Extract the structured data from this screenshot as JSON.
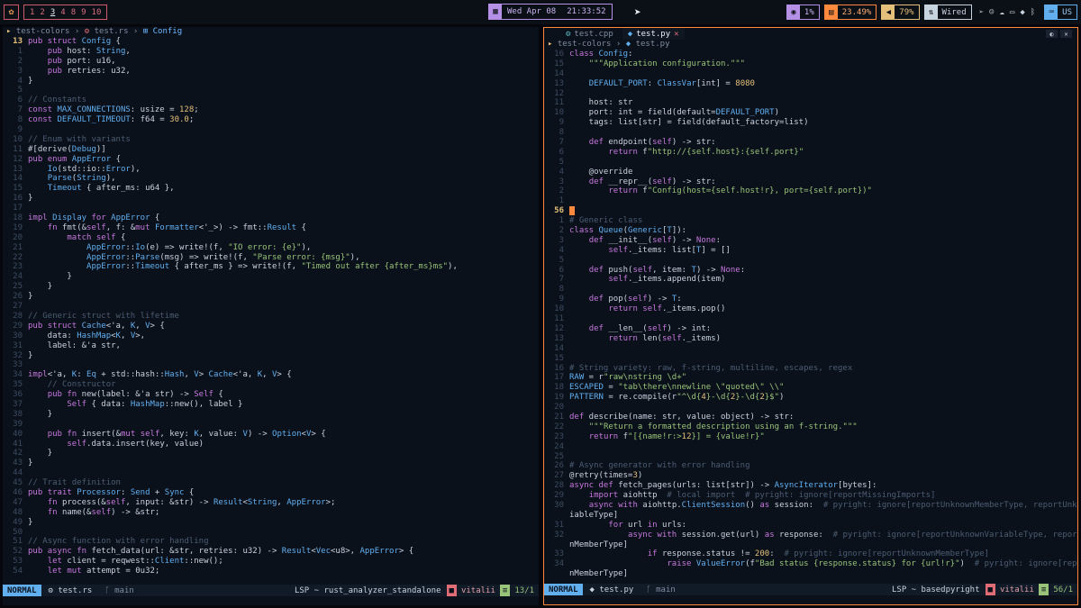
{
  "topbar": {
    "workspaces": [
      "1",
      "2",
      "3",
      "4",
      "8",
      "9",
      "10"
    ],
    "active_workspace": "3",
    "clock": {
      "date": "Wed Apr 08",
      "time": "21:33:52"
    },
    "cpu": "1%",
    "memory": "23.49%",
    "volume": "79%",
    "network": "Wired",
    "keyboard_layout": "US",
    "colors": {
      "cpu": "#b490e6",
      "mem": "#ff8a3d",
      "vol": "#e5c07b",
      "net": "#c8d3e0",
      "kbd": "#61afef"
    }
  },
  "left": {
    "breadcrumb": {
      "folder": "test-colors",
      "file": "test.rs",
      "symbol": "Config"
    },
    "lines": [
      {
        "n": "13",
        "t": "pub struct Config {"
      },
      {
        "n": "1",
        "t": "    pub host: String,"
      },
      {
        "n": "2",
        "t": "    pub port: u16,"
      },
      {
        "n": "3",
        "t": "    pub retries: u32,"
      },
      {
        "n": "4",
        "t": "}"
      },
      {
        "n": "5",
        "t": ""
      },
      {
        "n": "6",
        "t": "// Constants"
      },
      {
        "n": "7",
        "t": "const MAX_CONNECTIONS: usize = 128;"
      },
      {
        "n": "8",
        "t": "const DEFAULT_TIMEOUT: f64 = 30.0;"
      },
      {
        "n": "9",
        "t": ""
      },
      {
        "n": "10",
        "t": "// Enum with variants"
      },
      {
        "n": "11",
        "t": "#[derive(Debug)]"
      },
      {
        "n": "12",
        "t": "pub enum AppError {"
      },
      {
        "n": "13",
        "t": "    Io(std::io::Error),"
      },
      {
        "n": "14",
        "t": "    Parse(String),"
      },
      {
        "n": "15",
        "t": "    Timeout { after_ms: u64 },"
      },
      {
        "n": "16",
        "t": "}"
      },
      {
        "n": "17",
        "t": ""
      },
      {
        "n": "18",
        "t": "impl Display for AppError {"
      },
      {
        "n": "19",
        "t": "    fn fmt(&self, f: &mut Formatter<'_>) -> fmt::Result {"
      },
      {
        "n": "20",
        "t": "        match self {"
      },
      {
        "n": "21",
        "t": "            AppError::Io(e) => write!(f, \"IO error: {e}\"),"
      },
      {
        "n": "22",
        "t": "            AppError::Parse(msg) => write!(f, \"Parse error: {msg}\"),"
      },
      {
        "n": "23",
        "t": "            AppError::Timeout { after_ms } => write!(f, \"Timed out after {after_ms}ms\"),"
      },
      {
        "n": "24",
        "t": "        }"
      },
      {
        "n": "25",
        "t": "    }"
      },
      {
        "n": "26",
        "t": "}"
      },
      {
        "n": "27",
        "t": ""
      },
      {
        "n": "28",
        "t": "// Generic struct with lifetime"
      },
      {
        "n": "29",
        "t": "pub struct Cache<'a, K, V> {"
      },
      {
        "n": "30",
        "t": "    data: HashMap<K, V>,"
      },
      {
        "n": "31",
        "t": "    label: &'a str,"
      },
      {
        "n": "32",
        "t": "}"
      },
      {
        "n": "33",
        "t": ""
      },
      {
        "n": "34",
        "t": "impl<'a, K: Eq + std::hash::Hash, V> Cache<'a, K, V> {"
      },
      {
        "n": "35",
        "t": "    // Constructor"
      },
      {
        "n": "36",
        "t": "    pub fn new(label: &'a str) -> Self {"
      },
      {
        "n": "37",
        "t": "        Self { data: HashMap::new(), label }"
      },
      {
        "n": "38",
        "t": "    }"
      },
      {
        "n": "39",
        "t": ""
      },
      {
        "n": "40",
        "t": "    pub fn insert(&mut self, key: K, value: V) -> Option<V> {"
      },
      {
        "n": "41",
        "t": "        self.data.insert(key, value)"
      },
      {
        "n": "42",
        "t": "    }"
      },
      {
        "n": "43",
        "t": "}"
      },
      {
        "n": "44",
        "t": ""
      },
      {
        "n": "45",
        "t": "// Trait definition"
      },
      {
        "n": "46",
        "t": "pub trait Processor: Send + Sync {"
      },
      {
        "n": "47",
        "t": "    fn process(&self, input: &str) -> Result<String, AppError>;"
      },
      {
        "n": "48",
        "t": "    fn name(&self) -> &str;"
      },
      {
        "n": "49",
        "t": "}"
      },
      {
        "n": "50",
        "t": ""
      },
      {
        "n": "51",
        "t": "// Async function with error handling"
      },
      {
        "n": "52",
        "t": "pub async fn fetch_data(url: &str, retries: u32) -> Result<Vec<u8>, AppError> {"
      },
      {
        "n": "53",
        "t": "    let client = reqwest::Client::new();"
      },
      {
        "n": "54",
        "t": "    let mut attempt = 0u32;"
      }
    ],
    "status": {
      "mode": "NORMAL",
      "file": "test.rs",
      "branch": "main",
      "lsp": "LSP ~ rust_analyzer_standalone",
      "user": "vitalii",
      "position": "13/1"
    }
  },
  "right": {
    "tabs": [
      {
        "label": "test.cpp",
        "active": false
      },
      {
        "label": "test.py",
        "active": true
      }
    ],
    "breadcrumb": {
      "folder": "test-colors",
      "file": "test.py"
    },
    "lines": [
      {
        "n": "16",
        "t": "class Config:"
      },
      {
        "n": "15",
        "t": "    \"\"\"Application configuration.\"\"\""
      },
      {
        "n": "14",
        "t": ""
      },
      {
        "n": "13",
        "t": "    DEFAULT_PORT: ClassVar[int] = 8080"
      },
      {
        "n": "12",
        "t": ""
      },
      {
        "n": "11",
        "t": "    host: str"
      },
      {
        "n": "10",
        "t": "    port: int = field(default=DEFAULT_PORT)"
      },
      {
        "n": "9",
        "t": "    tags: list[str] = field(default_factory=list)"
      },
      {
        "n": "8",
        "t": ""
      },
      {
        "n": "7",
        "t": "    def endpoint(self) -> str:"
      },
      {
        "n": "6",
        "t": "        return f\"http://{self.host}:{self.port}\""
      },
      {
        "n": "5",
        "t": ""
      },
      {
        "n": "4",
        "t": "    @override"
      },
      {
        "n": "3",
        "t": "    def __repr__(self) -> str:"
      },
      {
        "n": "2",
        "t": "        return f\"Config(host={self.host!r}, port={self.port})\""
      },
      {
        "n": "1",
        "t": ""
      },
      {
        "n": "56",
        "t": ""
      },
      {
        "n": "1",
        "t": "# Generic class"
      },
      {
        "n": "2",
        "t": "class Queue(Generic[T]):"
      },
      {
        "n": "3",
        "t": "    def __init__(self) -> None:"
      },
      {
        "n": "4",
        "t": "        self._items: list[T] = []"
      },
      {
        "n": "5",
        "t": ""
      },
      {
        "n": "6",
        "t": "    def push(self, item: T) -> None:"
      },
      {
        "n": "7",
        "t": "        self._items.append(item)"
      },
      {
        "n": "8",
        "t": ""
      },
      {
        "n": "9",
        "t": "    def pop(self) -> T:"
      },
      {
        "n": "10",
        "t": "        return self._items.pop()"
      },
      {
        "n": "11",
        "t": ""
      },
      {
        "n": "12",
        "t": "    def __len__(self) -> int:"
      },
      {
        "n": "13",
        "t": "        return len(self._items)"
      },
      {
        "n": "14",
        "t": ""
      },
      {
        "n": "15",
        "t": ""
      },
      {
        "n": "16",
        "t": "# String variety: raw, f-string, multiline, escapes, regex"
      },
      {
        "n": "17",
        "t": "RAW = r\"raw\\nstring \\d+\""
      },
      {
        "n": "18",
        "t": "ESCAPED = \"tab\\there\\nnewline \\\"quoted\\\" \\\\\""
      },
      {
        "n": "19",
        "t": "PATTERN = re.compile(r\"^\\d{4}-\\d{2}-\\d{2}$\")"
      },
      {
        "n": "20",
        "t": ""
      },
      {
        "n": "21",
        "t": "def describe(name: str, value: object) -> str:"
      },
      {
        "n": "22",
        "t": "    \"\"\"Return a formatted description using an f-string.\"\"\""
      },
      {
        "n": "23",
        "t": "    return f\"[{name!r:>12}] = {value!r}\""
      },
      {
        "n": "24",
        "t": ""
      },
      {
        "n": "25",
        "t": ""
      },
      {
        "n": "26",
        "t": "# Async generator with error handling"
      },
      {
        "n": "27",
        "t": "@retry(times=3)"
      },
      {
        "n": "28",
        "t": "async def fetch_pages(urls: list[str]) -> AsyncIterator[bytes]:"
      },
      {
        "n": "29",
        "t": "    import aiohttp  # local import  # pyright: ignore[reportMissingImports]"
      },
      {
        "n": "30",
        "t": "    async with aiohttp.ClientSession() as session:  # pyright: ignore[reportUnknownMemberType, reportUnknownVar"
      },
      {
        "n": "",
        "t": "iableType]"
      },
      {
        "n": "31",
        "t": "        for url in urls:"
      },
      {
        "n": "32",
        "t": "            async with session.get(url) as response:  # pyright: ignore[reportUnknownVariableType, reportUnknow"
      },
      {
        "n": "",
        "t": "nMemberType]"
      },
      {
        "n": "33",
        "t": "                if response.status != 200:  # pyright: ignore[reportUnknownMemberType]"
      },
      {
        "n": "34",
        "t": "                    raise ValueError(f\"Bad status {response.status} for {url!r}\")  # pyright: ignore[reportUnknow"
      },
      {
        "n": "",
        "t": "nMemberType]"
      }
    ],
    "status": {
      "mode": "NORMAL",
      "file": "test.py",
      "branch": "main",
      "lsp": "LSP ~ basedpyright",
      "user": "vitalii",
      "position": "56/1"
    }
  }
}
